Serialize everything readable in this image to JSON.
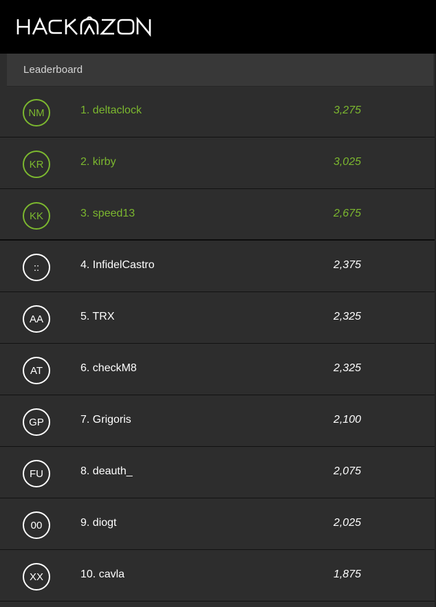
{
  "brand": {
    "logo_text": "HACKAZON"
  },
  "panel": {
    "title": "Leaderboard"
  },
  "colors": {
    "accent": "#7cb82f",
    "text": "#ffffff",
    "background": "#2d2d2d"
  },
  "leaderboard": [
    {
      "initials": "NM",
      "name": "1. deltaclock",
      "score": "3,275",
      "highlighted": true
    },
    {
      "initials": "KR",
      "name": "2. kirby",
      "score": "3,025",
      "highlighted": true
    },
    {
      "initials": "KK",
      "name": "3. speed13",
      "score": "2,675",
      "highlighted": true
    },
    {
      "initials": "::",
      "name": "4. InfidelCastro",
      "score": "2,375",
      "highlighted": false
    },
    {
      "initials": "AA",
      "name": "5. TRX",
      "score": "2,325",
      "highlighted": false
    },
    {
      "initials": "AT",
      "name": "6. checkM8",
      "score": "2,325",
      "highlighted": false
    },
    {
      "initials": "GP",
      "name": "7. Grigoris",
      "score": "2,100",
      "highlighted": false
    },
    {
      "initials": "FU",
      "name": "8. deauth_",
      "score": "2,075",
      "highlighted": false
    },
    {
      "initials": "00",
      "name": "9. diogt",
      "score": "2,025",
      "highlighted": false
    },
    {
      "initials": "XX",
      "name": "10. cavla",
      "score": "1,875",
      "highlighted": false
    }
  ]
}
